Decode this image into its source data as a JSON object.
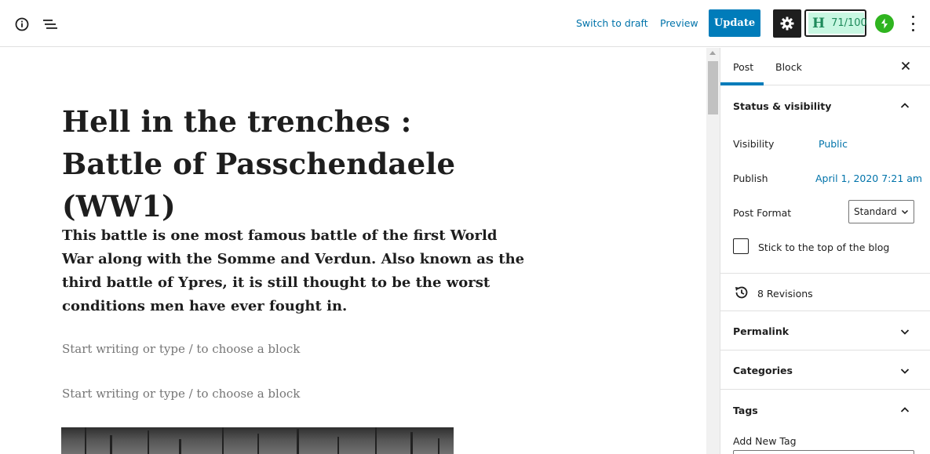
{
  "toolbar": {
    "switch_to_draft": "Switch to draft",
    "preview": "Preview",
    "update": "Update",
    "score_letter": "H",
    "score_value": "71/100",
    "icons": [
      "info-icon",
      "list-view-icon",
      "gear-icon",
      "jetpack-icon",
      "more-vertical-icon"
    ]
  },
  "editor": {
    "title": "Hell in the trenches : Battle of Passchendaele (WW1)",
    "intro": "This battle is one most famous battle of the first World War along with the Somme and Verdun. Also known as the third battle of Ypres, it is still thought to be the worst conditions men have ever fought in.",
    "placeholders": [
      "Start writing or type / to choose a block",
      "Start writing or type / to choose a block"
    ]
  },
  "sidebar": {
    "tabs": [
      "Post",
      "Block"
    ],
    "status_visibility": {
      "title": "Status & visibility",
      "visibility_label": "Visibility",
      "visibility_value": "Public",
      "publish_label": "Publish",
      "publish_value": "April 1, 2020 7:21 am",
      "post_format_label": "Post Format",
      "post_format_value": "Standard",
      "sticky_label": "Stick to the top of the blog"
    },
    "revisions": "8 Revisions",
    "permalink": "Permalink",
    "categories": "Categories",
    "tags": "Tags",
    "add_new_tag": "Add New Tag"
  },
  "colors": {
    "accent": "#007cba",
    "link": "#0073aa",
    "score_bg": "#c8f7e2",
    "score_text": "#1e8a5b",
    "jetpack": "#2fb41f"
  }
}
